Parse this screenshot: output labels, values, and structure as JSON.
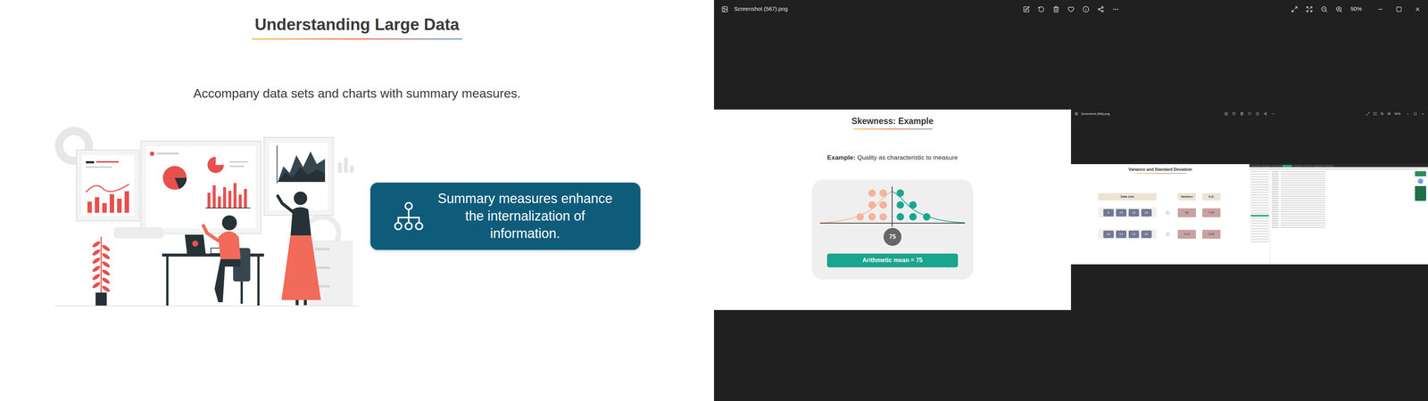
{
  "slide": {
    "title": "Understanding Large Data",
    "subtitle": "Accompany data sets and charts with summary measures.",
    "callout": "Summary measures enhance the internalization of information."
  },
  "viewer": {
    "title": "Screenshot (567).png",
    "zoom": "50%",
    "image": {
      "slide": {
        "title": "Skewness: Example",
        "example_label": "Example:",
        "example_text": "Quality as characteristic to measure",
        "chart": {
          "dot_columns": [
            {
              "count": 1,
              "color": "#f5b39b"
            },
            {
              "count": 3,
              "color": "#f5b39b"
            },
            {
              "count": 3,
              "color": "#f5b39b"
            },
            {
              "count": 3,
              "color": "#1aa58e"
            },
            {
              "count": 2,
              "color": "#1aa58e"
            },
            {
              "count": 1,
              "color": "#1aa58e"
            }
          ],
          "mean": "75",
          "caption": "Arithmetic mean = 75"
        }
      },
      "viewer": {
        "title": "Screenshot (566).png",
        "zoom": "50%",
        "image": {
          "slide": {
            "title": "Variance and Standard Deviation",
            "columns": [
              "Data sets",
              "Variance",
              "S.D."
            ],
            "equals": "=",
            "rows": [
              {
                "values": [
                  "5",
                  "13",
                  "13",
                  "25"
                ],
                "variance": "55",
                "sd": "7.42"
              },
              {
                "values": [
                  "10",
                  "13",
                  "13",
                  "20"
                ],
                "variance": "12.5",
                "sd": "3.53"
              }
            ]
          }
        }
      }
    }
  }
}
